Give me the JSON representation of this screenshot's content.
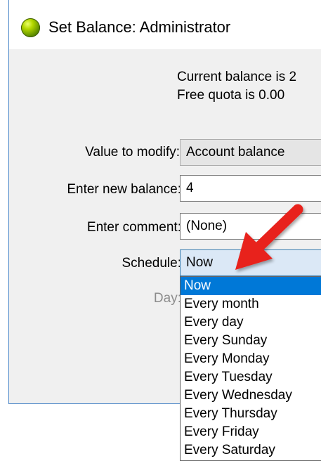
{
  "window": {
    "title": "Set Balance: Administrator",
    "info_line1": "Current balance is 2",
    "info_line2": "Free quota is 0.00"
  },
  "form": {
    "value_to_modify_label": "Value to modify:",
    "value_to_modify": "Account balance",
    "new_balance_label": "Enter new balance:",
    "new_balance": "4",
    "comment_label": "Enter comment:",
    "comment": "(None)",
    "schedule_label": "Schedule:",
    "schedule": "Now",
    "day_label": "Day:"
  },
  "schedule_options": [
    "Now",
    "Every month",
    "Every day",
    "Every Sunday",
    "Every Monday",
    "Every Tuesday",
    "Every Wednesday",
    "Every Thursday",
    "Every Friday",
    "Every Saturday"
  ],
  "colors": {
    "annotation_arrow": "#e8241f",
    "selected_highlight": "#0078d7"
  }
}
